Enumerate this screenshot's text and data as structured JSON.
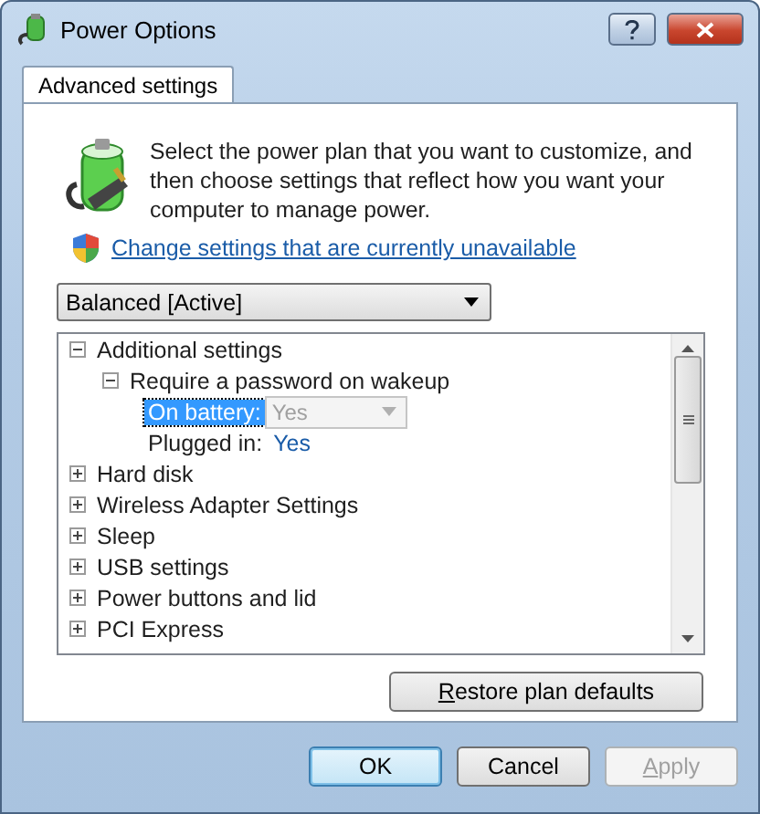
{
  "window": {
    "title": "Power Options"
  },
  "tabs": [
    {
      "label": "Advanced settings",
      "selected": true
    }
  ],
  "intro": "Select the power plan that you want to customize, and then choose settings that reflect how you want your computer to manage power.",
  "link": "Change settings that are currently unavailable",
  "plan_select": {
    "value": "Balanced [Active]"
  },
  "settings_tree": [
    {
      "kind": "group",
      "label": "Additional settings",
      "expanded": true,
      "children": [
        {
          "kind": "group",
          "label": "Require a password on wakeup",
          "expanded": true,
          "children": [
            {
              "kind": "setting",
              "label": "On battery:",
              "value": "Yes",
              "selected": true
            },
            {
              "kind": "setting",
              "label": "Plugged in:",
              "value": "Yes",
              "selected": false
            }
          ]
        }
      ]
    },
    {
      "kind": "group",
      "label": "Hard disk",
      "expanded": false
    },
    {
      "kind": "group",
      "label": "Wireless Adapter Settings",
      "expanded": false
    },
    {
      "kind": "group",
      "label": "Sleep",
      "expanded": false
    },
    {
      "kind": "group",
      "label": "USB settings",
      "expanded": false
    },
    {
      "kind": "group",
      "label": "Power buttons and lid",
      "expanded": false
    },
    {
      "kind": "group",
      "label": "PCI Express",
      "expanded": false
    }
  ],
  "restore_button": {
    "label": "Restore plan defaults",
    "underline_first_letter": true
  },
  "dialog_buttons": [
    {
      "label": "OK",
      "default": true,
      "disabled": false,
      "underline_first_letter": false
    },
    {
      "label": "Cancel",
      "default": false,
      "disabled": false,
      "underline_first_letter": false
    },
    {
      "label": "Apply",
      "default": false,
      "disabled": true,
      "underline_first_letter": true
    }
  ]
}
